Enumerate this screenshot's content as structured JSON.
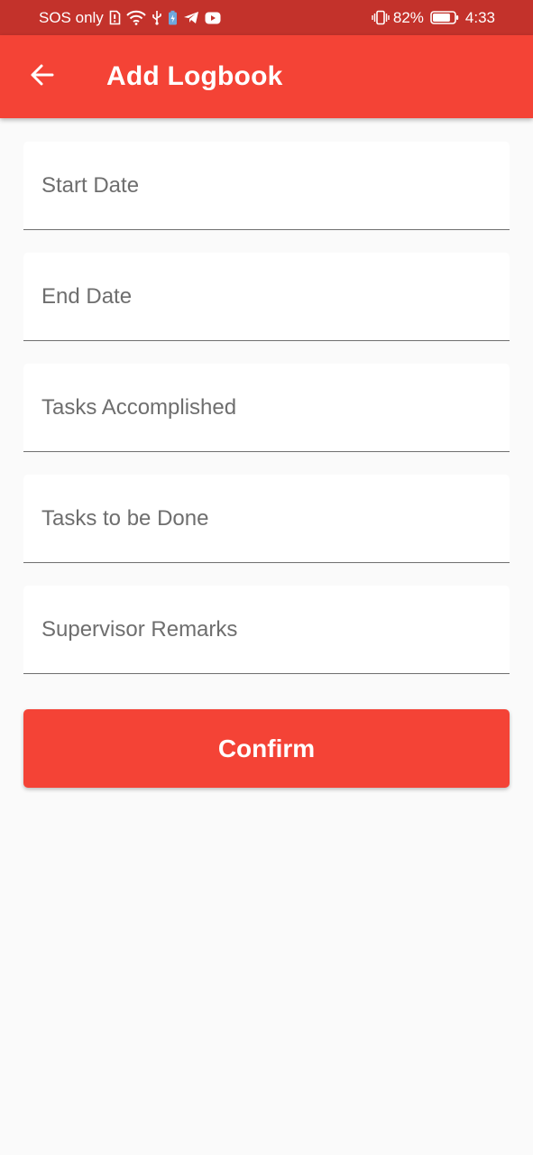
{
  "status_bar": {
    "carrier": "SOS only",
    "battery_percent": "82%",
    "time": "4:33",
    "icons_left": [
      "sim-icon",
      "wifi-icon",
      "usb-icon",
      "battery-saver-icon",
      "telegram-icon",
      "youtube-icon"
    ],
    "icons_right": [
      "vibrate-icon",
      "battery-icon"
    ],
    "battery_level": 0.82
  },
  "app_bar": {
    "title": "Add Logbook",
    "back_icon": "arrow-back-icon",
    "color": "#f44336"
  },
  "form": {
    "fields": [
      {
        "placeholder": "Start Date",
        "value": ""
      },
      {
        "placeholder": "End Date",
        "value": ""
      },
      {
        "placeholder": "Tasks Accomplished",
        "value": ""
      },
      {
        "placeholder": "Tasks to be Done",
        "value": ""
      },
      {
        "placeholder": "Supervisor Remarks",
        "value": ""
      }
    ],
    "confirm_label": "Confirm"
  },
  "colors": {
    "accent": "#f44336",
    "status_bar": "#c3322b",
    "background": "#fafafa"
  }
}
